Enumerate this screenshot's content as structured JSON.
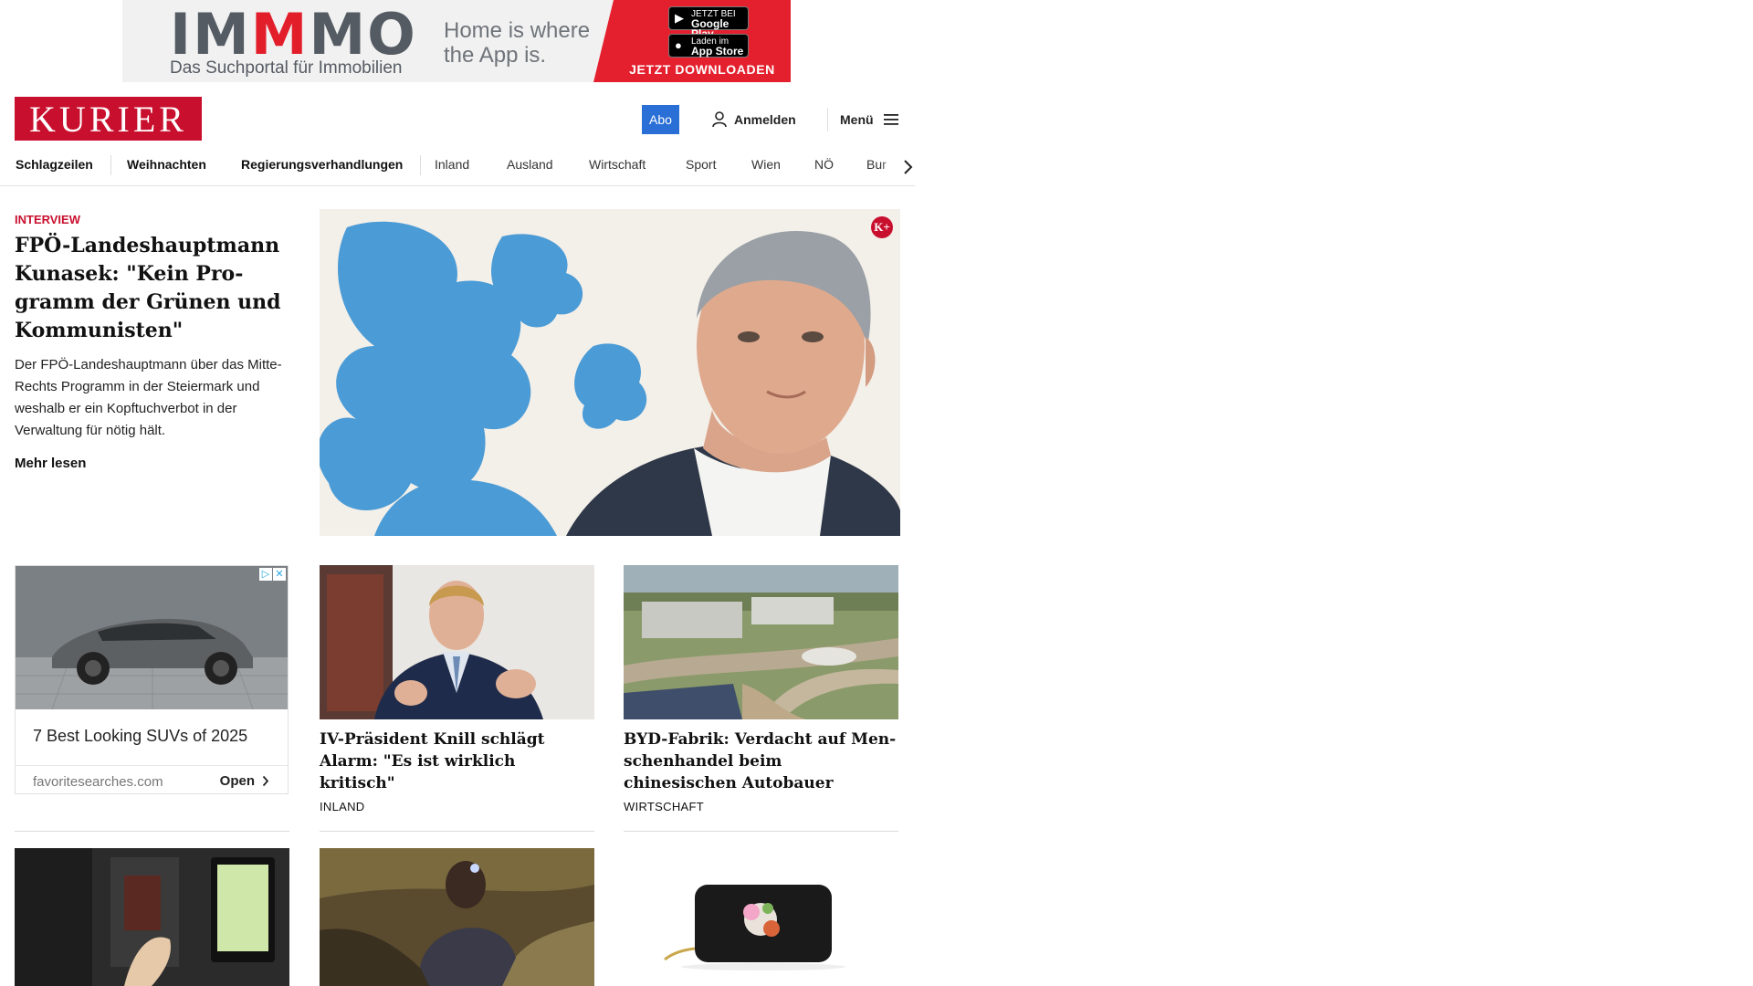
{
  "top_ad": {
    "brand": "IMMMO",
    "tagline": "Das Suchportal für Immobilien",
    "slogan": "Home is where the App is.",
    "google_play": {
      "small": "JETZT BEI",
      "big": "Google Play"
    },
    "app_store": {
      "small": "Laden im",
      "big": "App Store"
    },
    "cta": "JETZT DOWNLOADEN"
  },
  "header": {
    "logo": "KURIER",
    "abo_label": "Abo",
    "login_label": "Anmelden",
    "menu_label": "Menü"
  },
  "nav": {
    "items": [
      "Schlagzeilen",
      "Weihnachten",
      "Regierungsverhandlungen",
      "Inland",
      "Ausland",
      "Wirtschaft",
      "Sport",
      "Wien",
      "NÖ",
      "Bur"
    ]
  },
  "lead": {
    "kicker": "INTERVIEW",
    "title": "FPÖ-Landeshauptmann Kunasek: \"Kein Pro-gramm der Grünen und Kommunisten\"",
    "teaser": "Der FPÖ-Landeshauptmann über das Mitte-Rechts Programm in der Steiermark und weshalb er ein Kopftuchverbot in der Verwaltung für nötig hält.",
    "more": "Mehr lesen",
    "badge": "K+"
  },
  "ad_card": {
    "title": "7 Best Looking SUVs of 2025",
    "domain": "favoritesearches.com",
    "open_label": "Open"
  },
  "teasers": [
    {
      "title": "IV-Präsident Knill schlägt Alarm: \"Es ist wirklich kritisch\"",
      "category": "INLAND"
    },
    {
      "title": "BYD-Fabrik: Verdacht auf Men-schenhandel beim chinesischen Autobauer",
      "category": "WIRTSCHAFT"
    }
  ],
  "colors": {
    "brand_red": "#c8102e",
    "abo_blue": "#2a6fd6",
    "ad_red": "#e4202e"
  }
}
